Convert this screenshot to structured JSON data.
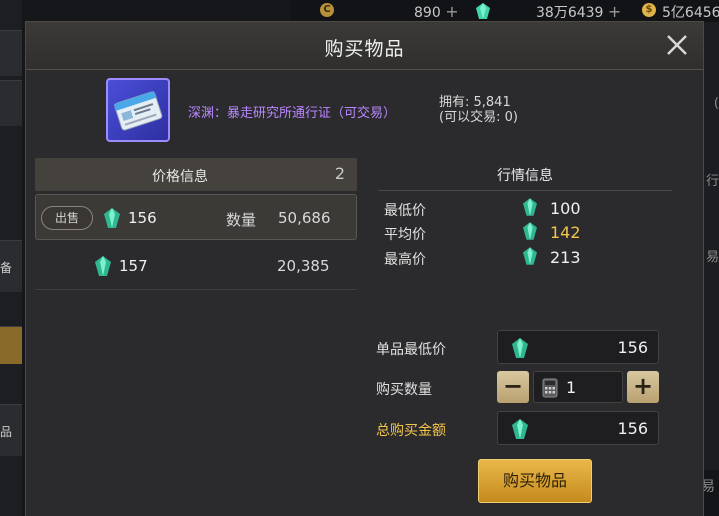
{
  "background": {
    "left_tabs": [
      "备",
      "品"
    ],
    "right_fragments": [
      "行",
      "易",
      "(",
      "易"
    ],
    "bottom_fragment": "易",
    "bottom_right_icon": "close-icon"
  },
  "currency_bar": [
    {
      "icon": "coin-icon",
      "value": "890"
    },
    {
      "icon": "gem-icon",
      "value": "38万6439"
    },
    {
      "icon": "gold-icon",
      "value": "5亿6456"
    }
  ],
  "dialog": {
    "title": "购买物品",
    "close_icon": "close-icon",
    "item": {
      "name": "深渊：暴走研究所通行证（可交易）",
      "owned_label": "拥有: 5,841",
      "tradable_label": "(可以交易: 0)",
      "icon": "pass-card-icon",
      "rarity_color": "#9b8cff"
    },
    "price_info": {
      "title": "价格信息",
      "count": "2",
      "listings": [
        {
          "badge": "出售",
          "price": "156",
          "qty_label": "数量",
          "qty": "50,686"
        },
        {
          "price": "157",
          "qty": "20,385"
        }
      ]
    },
    "market_info": {
      "title": "行情信息",
      "rows": [
        {
          "label": "最低价",
          "value": "100"
        },
        {
          "label": "平均价",
          "value": "142"
        },
        {
          "label": "最高价",
          "value": "213"
        }
      ]
    },
    "form": {
      "unit_price_label": "单品最低价",
      "unit_price": "156",
      "qty_label": "购买数量",
      "qty": "1",
      "minus": "−",
      "plus": "+",
      "total_label": "总购买金额",
      "total": "156"
    },
    "buy_button": "购买物品"
  },
  "colors": {
    "accent_gold": "#f2c44a",
    "item_name": "#b987ff",
    "gem": "#3fd6a8",
    "button": "#d9a33a"
  }
}
